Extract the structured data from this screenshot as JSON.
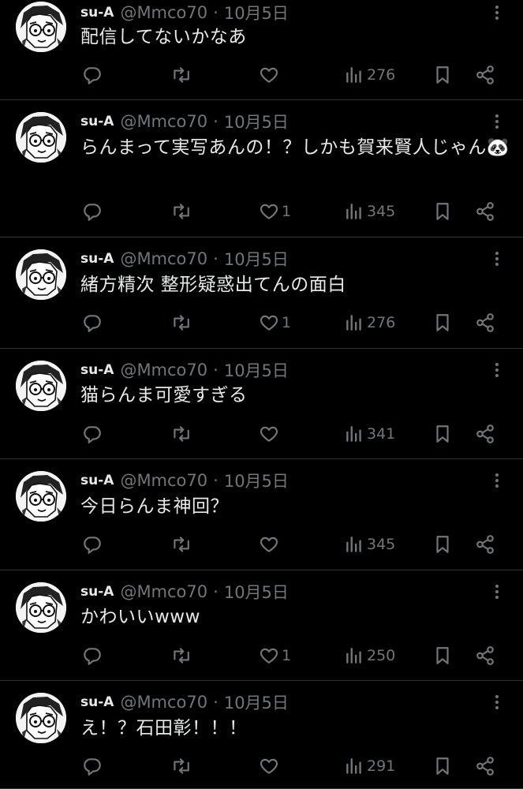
{
  "author": {
    "name": "su-A",
    "handle": "@Mmco70",
    "date": "10月5日",
    "separator": "·"
  },
  "tweets": [
    {
      "text": "配信してないかなあ",
      "likes": "",
      "views": "276"
    },
    {
      "text": "らんまって実写あんの！？しかも賀来賢人じゃん🐼",
      "likes": "1",
      "views": "345"
    },
    {
      "text": "緒方精次 整形疑惑出てんの面白",
      "likes": "1",
      "views": "276"
    },
    {
      "text": "猫らんま可愛すぎる",
      "likes": "",
      "views": "341"
    },
    {
      "text": "今日らんま神回？",
      "likes": "",
      "views": "345"
    },
    {
      "text": "かわいいwww",
      "likes": "1",
      "views": "250"
    },
    {
      "text": "え！？石田彰！！！",
      "likes": "",
      "views": "291"
    }
  ],
  "icons": [
    "avatar-manga-glasses",
    "reply-icon",
    "retweet-icon",
    "like-icon",
    "views-icon",
    "bookmark-icon",
    "share-icon",
    "more-icon"
  ],
  "colors": {
    "background": "#000000",
    "text": "#e7e9ea",
    "muted": "#71767b",
    "divider": "#2f3336"
  }
}
